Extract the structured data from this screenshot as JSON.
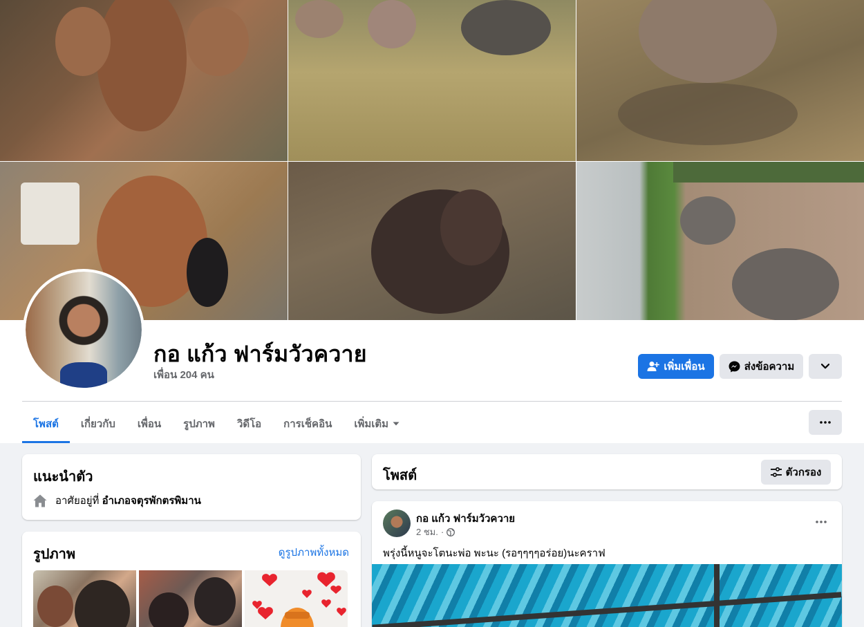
{
  "profile": {
    "name": "กอ แก้ว ฟาร์มวัวควาย",
    "friends_count": "เพื่อน 204 คน"
  },
  "actions": {
    "add_friend": "เพิ่มเพื่อน",
    "message": "ส่งข้อความ"
  },
  "tabs": [
    {
      "label": "โพสต์",
      "active": true
    },
    {
      "label": "เกี่ยวกับ"
    },
    {
      "label": "เพื่อน"
    },
    {
      "label": "รูปภาพ"
    },
    {
      "label": "วิดีโอ"
    },
    {
      "label": "การเช็คอิน"
    },
    {
      "label": "เพิ่มเติม"
    }
  ],
  "intro": {
    "title": "แนะนำตัว",
    "lives_in_prefix": "อาศัยอยู่ที่",
    "lives_in_place": "อำเภอจตุรพักตรพิมาน"
  },
  "photos": {
    "title": "รูปภาพ",
    "see_all": "ดูรูปภาพทั้งหมด"
  },
  "posts": {
    "title": "โพสต์",
    "filter": "ตัวกรอง"
  },
  "post": {
    "author": "กอ แก้ว ฟาร์มวัวควาย",
    "time": "2 ชม.",
    "text": "พรุ่งนี้หนูจะโตนะพ่อ  พะนะ   (รอๆๆๆๆอร่อย)นะคราฟ"
  },
  "colors": {
    "accent": "#1b74e4",
    "page_bg": "#f0f2f5",
    "secondary_text": "#65676b"
  },
  "icons": {
    "add_friend": "add-friend-icon",
    "messenger": "messenger-icon",
    "chevron": "chevron-down-icon",
    "more": "more-horizontal-icon",
    "home": "home-icon",
    "filter": "filter-icon",
    "globe": "globe-icon"
  }
}
